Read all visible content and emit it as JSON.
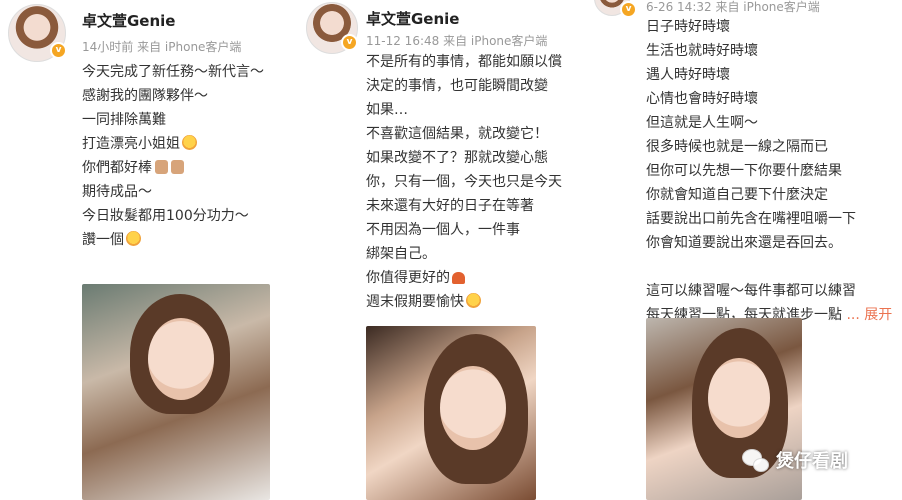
{
  "posts": [
    {
      "username": "卓文萱Genie",
      "time": "14小时前",
      "source": "来自 iPhone客户端",
      "lines": [
        "今天完成了新任務～新代言～",
        "感謝我的團隊夥伴～",
        "一同排除萬難",
        "打造漂亮小姐姐",
        "你們都好棒",
        "期待成品～",
        "今日妝髮都用100分功力～",
        "讚一個"
      ]
    },
    {
      "username": "卓文萱Genie",
      "time": "11-12 16:48",
      "source": "来自 iPhone客户端",
      "lines": [
        "不是所有的事情，都能如願以償",
        "決定的事情，也可能瞬間改變",
        "如果…",
        "不喜歡這個結果，就改變它！",
        "如果改變不了？那就改變心態",
        "你，只有一個，今天也只是今天",
        "未來還有大好的日子在等著",
        "不用因為一個人，一件事",
        "綁架自己。",
        "你值得更好的",
        "週末假期要愉快"
      ]
    },
    {
      "time": "6-26 14:32",
      "source": "来自 iPhone客户端",
      "lines": [
        "日子時好時壞",
        "生活也就時好時壞",
        "遇人時好時壞",
        "心情也會時好時壞",
        "但這就是人生啊～",
        "很多時候也就是一線之隔而已",
        "但你可以先想一下你要什麼結果",
        "你就會知道自己要下什麼決定",
        "話要說出口前先含在嘴裡咀嚼一下",
        "你會知道要說出來還是吞回去。",
        "",
        "這可以練習喔～每件事都可以練習",
        "每天練習一點，每天就進步一點"
      ],
      "expand_label": "... 展开"
    }
  ],
  "watermark": {
    "text": "煲仔看剧"
  },
  "icons": [
    "verified-v-icon",
    "blush-emoji-icon",
    "thumbs-up-emoji-icon",
    "heart-emoji-icon",
    "smile-emoji-icon",
    "wechat-icon"
  ],
  "colors": {
    "expand": "#eb7350",
    "badge": "#f5a623",
    "meta": "#999999"
  }
}
